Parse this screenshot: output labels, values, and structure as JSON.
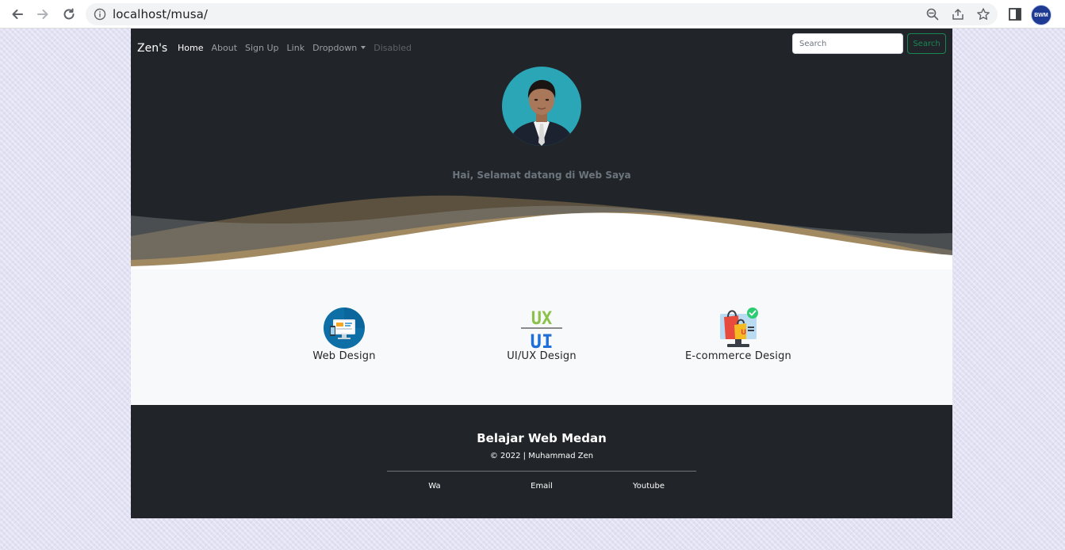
{
  "browser": {
    "url": "localhost/musa/",
    "profile_initials": "BWM"
  },
  "navbar": {
    "brand": "Zen's",
    "links": [
      {
        "label": "Home",
        "state": "active"
      },
      {
        "label": "About",
        "state": "normal"
      },
      {
        "label": "Sign Up",
        "state": "normal"
      },
      {
        "label": "Link",
        "state": "normal"
      },
      {
        "label": "Dropdown",
        "state": "dropdown"
      },
      {
        "label": "Disabled",
        "state": "disabled"
      }
    ],
    "search_placeholder": "Search",
    "search_button": "Search"
  },
  "hero": {
    "welcome": "Hai, Selamat datang di Web Saya"
  },
  "services": [
    {
      "label": "Web Design",
      "icon": "monitor-icon"
    },
    {
      "label": "UI/UX Design",
      "icon": "ux-ui-icon"
    },
    {
      "label": "E-commerce Design",
      "icon": "shopping-bag-icon"
    }
  ],
  "footer": {
    "title": "Belajar Web Medan",
    "copyright": "© 2022 | Muhammad Zen",
    "links": [
      "Wa",
      "Email",
      "Youtube"
    ]
  },
  "colors": {
    "dark": "#212529",
    "light": "#f8f9fa",
    "success": "#198754",
    "wave": "#c8a266"
  }
}
